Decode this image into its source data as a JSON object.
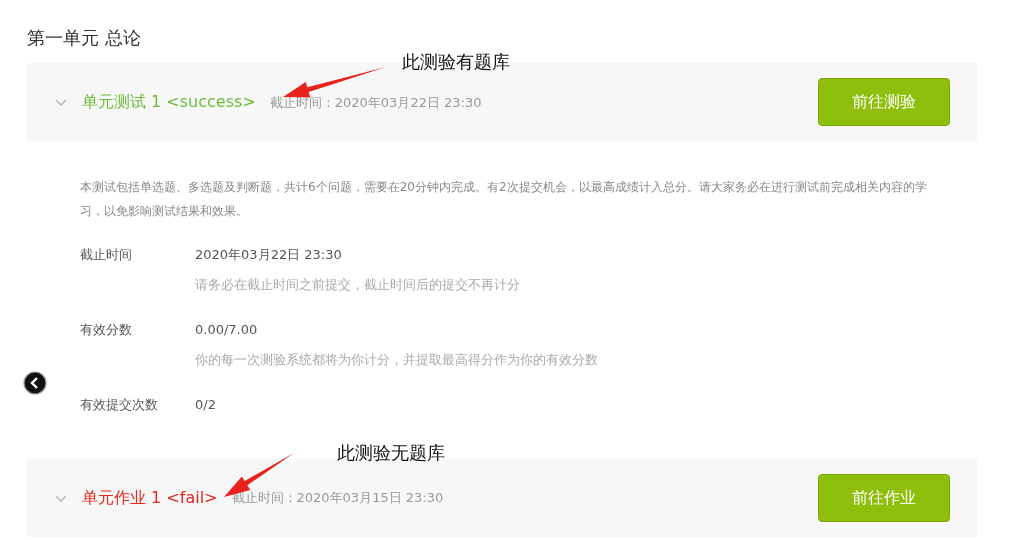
{
  "unit_title": "第一单元 总论",
  "items": [
    {
      "title": "单元测试 1 <success>",
      "color": "#6cbb3c",
      "deadline": "截止时间：2020年03月22日 23:30",
      "button": "前往测验",
      "description": "本测试包括单选题、多选题及判断题，共计6个问题，需要在20分钟内完成。有2次提交机会，以最高成绩计入总分。请大家务必在进行测试前完成相关内容的学习，以免影响测试结果和效果。",
      "details": [
        {
          "label": "截止时间",
          "value": "2020年03月22日 23:30",
          "note": "请务必在截止时间之前提交，截止时间后的提交不再计分"
        },
        {
          "label": "有效分数",
          "value": "0.00/7.00",
          "note": "你的每一次测验系统都将为你计分，并提取最高得分作为你的有效分数"
        },
        {
          "label": "有效提交次数",
          "value": "0/2"
        }
      ]
    },
    {
      "title": "单元作业 1 <fail>",
      "color": "#e3291f",
      "deadline": "截止时间：2020年03月15日 23:30",
      "button": "前往作业"
    }
  ],
  "annotations": [
    {
      "text": "此测验有题库"
    },
    {
      "text": "此测验无题库"
    }
  ]
}
